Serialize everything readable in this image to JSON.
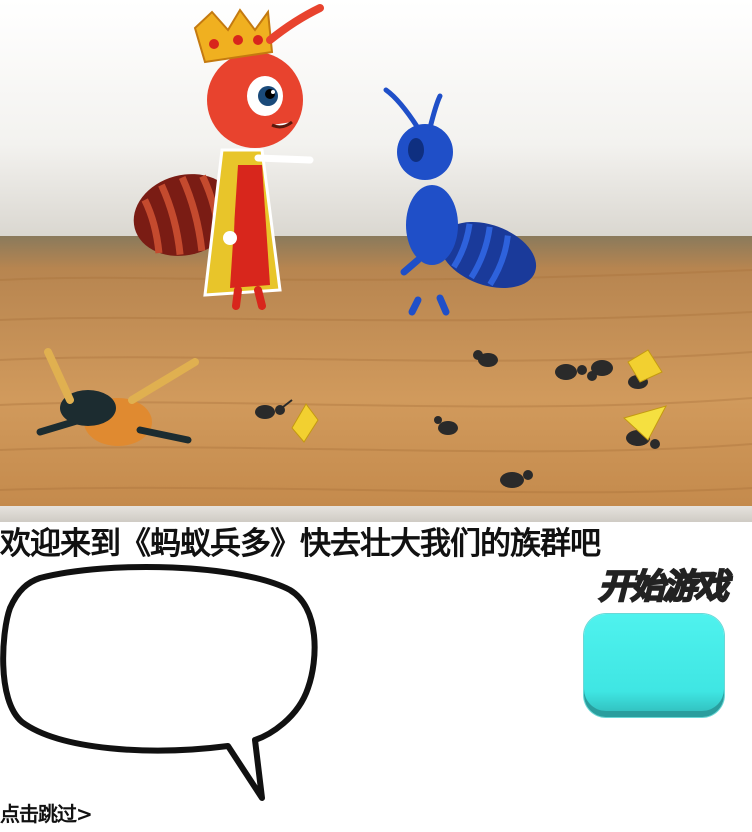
{
  "intro": {
    "message": "欢迎来到《蚂蚁兵多》快去壮大我们的族群吧"
  },
  "start": {
    "label": "开始游戏"
  },
  "skip": {
    "label": "点击跳过>"
  },
  "colors": {
    "start_button": "#44ECE8",
    "queen_red": "#E8432E",
    "soldier_blue": "#1F4FC8",
    "floor_wood": "#C98A4E"
  },
  "icons": {
    "queen": "queen-ant-character",
    "soldier": "blue-soldier-ant-character",
    "beetle": "fallen-beetle",
    "speech": "speech-bubble"
  }
}
